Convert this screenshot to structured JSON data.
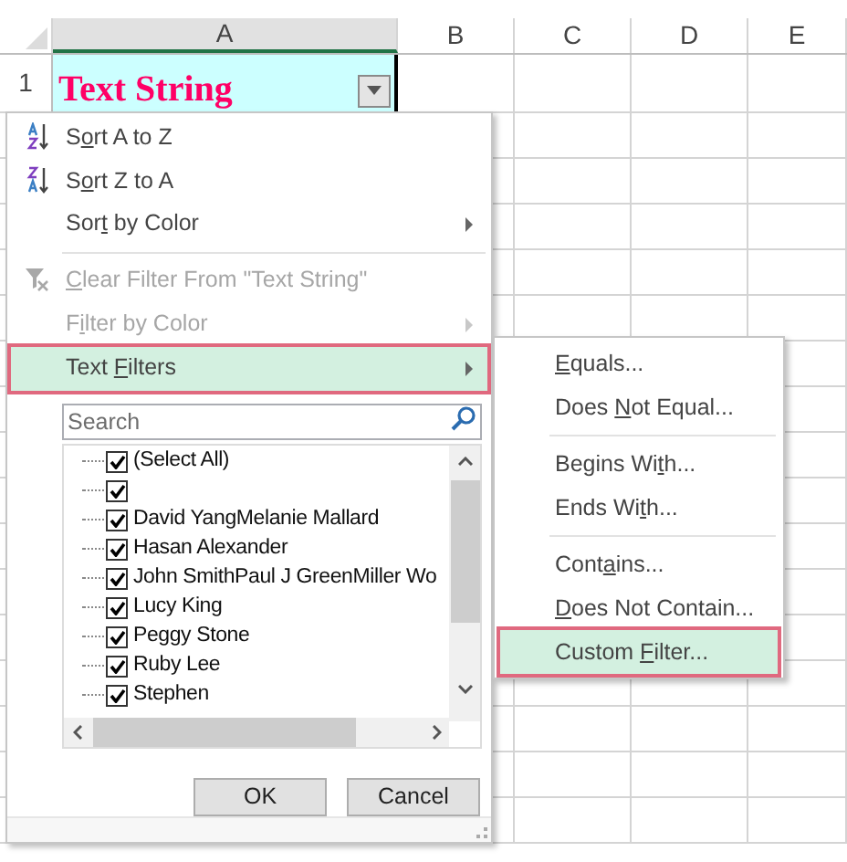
{
  "sheet": {
    "columns": [
      "A",
      "B",
      "C",
      "D",
      "E"
    ],
    "rows": [
      "1"
    ],
    "cell_a1": "Text String"
  },
  "menu": {
    "items": [
      {
        "kind": "sort_ascending",
        "text": {
          "before": "S",
          "key": "o",
          "after": "rt A to Z"
        },
        "disabled": false,
        "submenu": false,
        "selected": false
      },
      {
        "kind": "sort_descending",
        "text": {
          "before": "S",
          "key": "o",
          "after": "rt Z to A"
        },
        "disabled": false,
        "submenu": false,
        "selected": false
      },
      {
        "kind": "command",
        "text": {
          "before": "Sor",
          "key": "t",
          "after": " by Color"
        },
        "disabled": false,
        "submenu": true,
        "selected": false
      },
      {
        "kind": "separator"
      },
      {
        "kind": "clear_filter",
        "text": {
          "key": "C",
          "after": "lear Filter From \"Text String\""
        },
        "disabled": true,
        "submenu": false,
        "selected": false
      },
      {
        "kind": "command",
        "text": {
          "before": "F",
          "key": "i",
          "after": "lter by Color"
        },
        "disabled": true,
        "submenu": true,
        "selected": false
      },
      {
        "kind": "command",
        "text": {
          "before": "Text ",
          "key": "F",
          "after": "ilters"
        },
        "disabled": false,
        "submenu": true,
        "selected": true
      }
    ],
    "search": {
      "placeholder": "Search"
    },
    "values": [
      {
        "label": "(Select All)",
        "checked": true
      },
      {
        "checked": true
      },
      {
        "label": "David YangMelanie Mallard",
        "checked": true
      },
      {
        "label": "Hasan Alexander",
        "checked": true
      },
      {
        "label": "John SmithPaul J GreenMiller Wo",
        "checked": true
      },
      {
        "label": "Lucy King",
        "checked": true
      },
      {
        "label": "Peggy Stone",
        "checked": true
      },
      {
        "label": "Ruby Lee",
        "checked": true
      },
      {
        "label": "Stephen",
        "checked": true
      }
    ],
    "buttons": [
      "OK",
      "Cancel"
    ]
  },
  "submenu": {
    "items": [
      {
        "kind": "command",
        "text": {
          "key": "E",
          "after": "quals..."
        },
        "selected": false
      },
      {
        "kind": "command",
        "text": {
          "before": "Does ",
          "key": "N",
          "after": "ot Equal..."
        },
        "selected": false
      },
      {
        "kind": "separator"
      },
      {
        "kind": "command",
        "text": {
          "before": "Begins Wi",
          "key": "t",
          "after": "h..."
        },
        "selected": false
      },
      {
        "kind": "command",
        "text": {
          "before": "Ends Wi",
          "key": "t",
          "after": "h..."
        },
        "selected": false
      },
      {
        "kind": "separator"
      },
      {
        "kind": "command",
        "text": {
          "before": "Cont",
          "key": "a",
          "after": "ins..."
        },
        "selected": false
      },
      {
        "kind": "command",
        "text": {
          "key": "D",
          "after": "oes Not Contain..."
        },
        "selected": false
      },
      {
        "kind": "command",
        "text": {
          "before": "Custom ",
          "key": "F",
          "after": "ilter..."
        },
        "selected": true
      }
    ]
  }
}
